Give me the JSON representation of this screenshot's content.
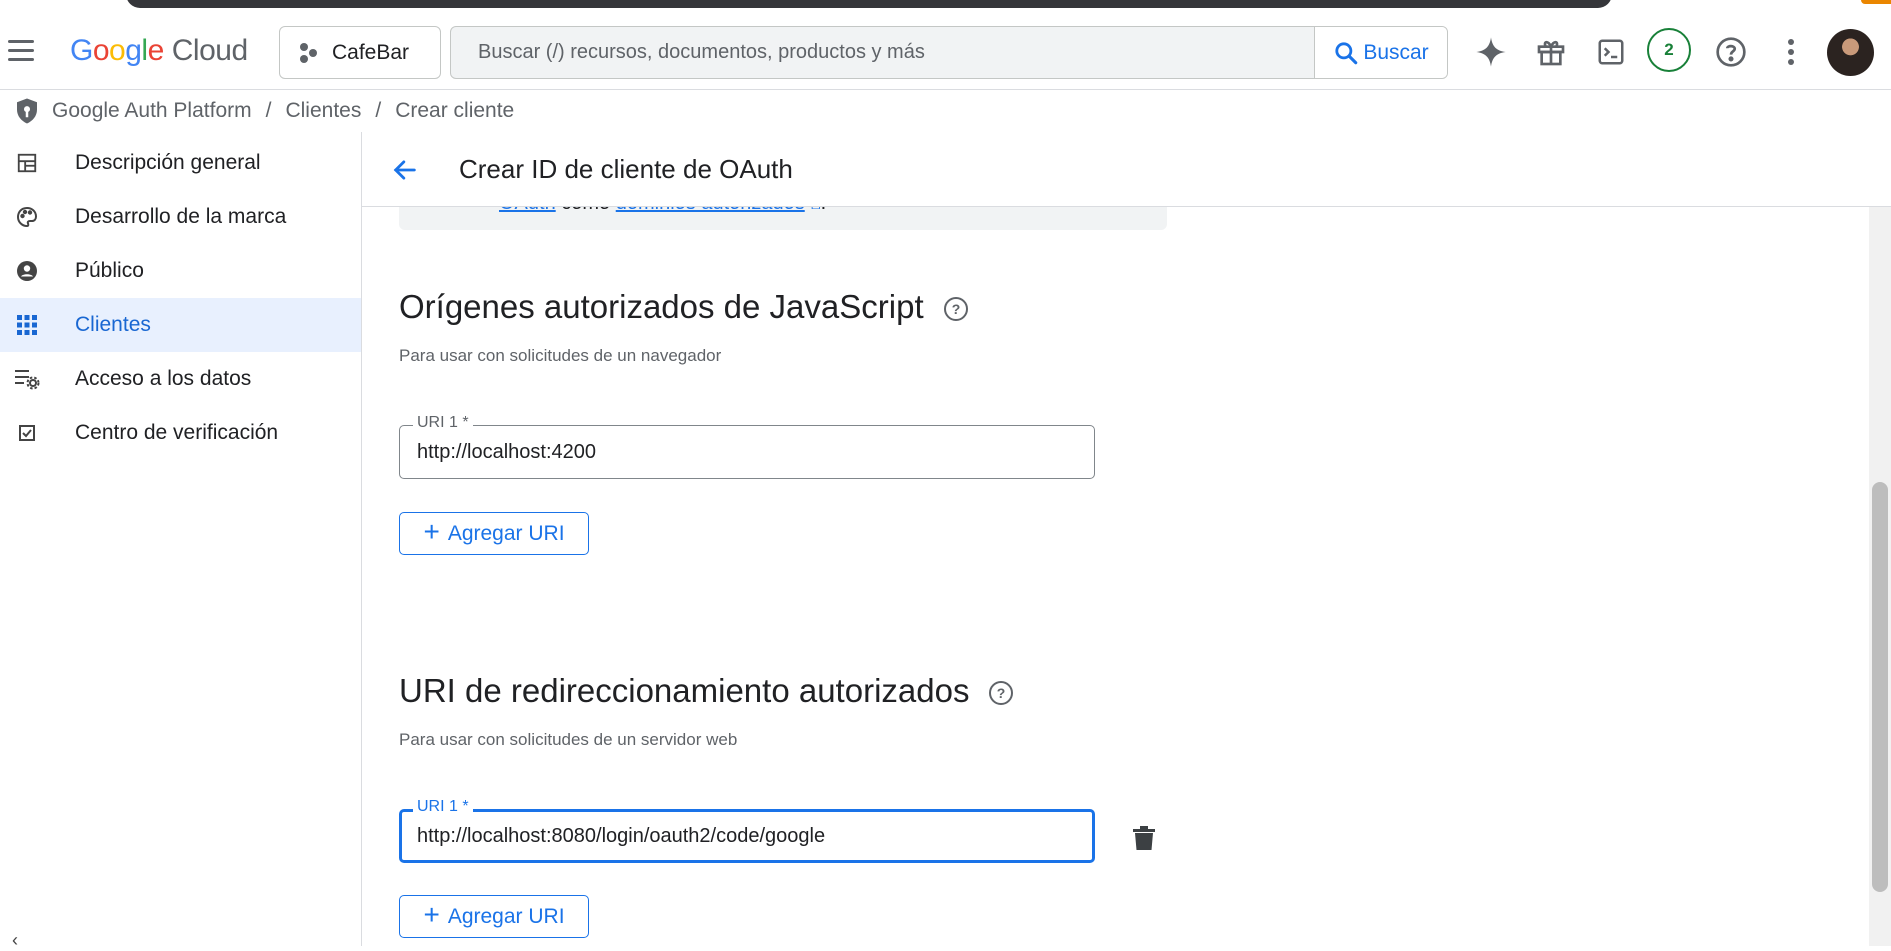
{
  "header": {
    "logo_google": "Google",
    "logo_cloud": "Cloud",
    "project": "CafeBar",
    "search_placeholder": "Buscar (/) recursos, documentos, productos y más",
    "search_button": "Buscar",
    "notifications_count": "2"
  },
  "breadcrumb": {
    "items": [
      "Google Auth Platform",
      "Clientes",
      "Crear cliente"
    ]
  },
  "sidebar": {
    "items": [
      {
        "label": "Descripción general",
        "icon": "dashboard-icon"
      },
      {
        "label": "Desarrollo de la marca",
        "icon": "palette-icon"
      },
      {
        "label": "Público",
        "icon": "person-icon"
      },
      {
        "label": "Clientes",
        "icon": "grid-icon",
        "active": true
      },
      {
        "label": "Acceso a los datos",
        "icon": "settings-list-icon"
      },
      {
        "label": "Centro de verificación",
        "icon": "checkbox-icon"
      }
    ]
  },
  "page": {
    "title": "Crear ID de cliente de OAuth",
    "info_link1": "OAuth",
    "info_mid": " como ",
    "info_link2": "dominios autorizados",
    "info_end": "."
  },
  "js_origins": {
    "title": "Orígenes autorizados de JavaScript",
    "subtitle": "Para usar con solicitudes de un navegador",
    "uri_label": "URI 1 *",
    "uri_value": "http://localhost:4200",
    "add_label": "Agregar URI"
  },
  "redirect_uris": {
    "title": "URI de redireccionamiento autorizados",
    "subtitle": "Para usar con solicitudes de un servidor web",
    "uri_label": "URI 1 *",
    "uri_value": "http://localhost:8080/login/oauth2/code/google",
    "add_label": "Agregar URI"
  },
  "colors": {
    "accent": "#1a73e8",
    "active_nav_bg": "#e8f0fe",
    "badge": "#188038"
  }
}
